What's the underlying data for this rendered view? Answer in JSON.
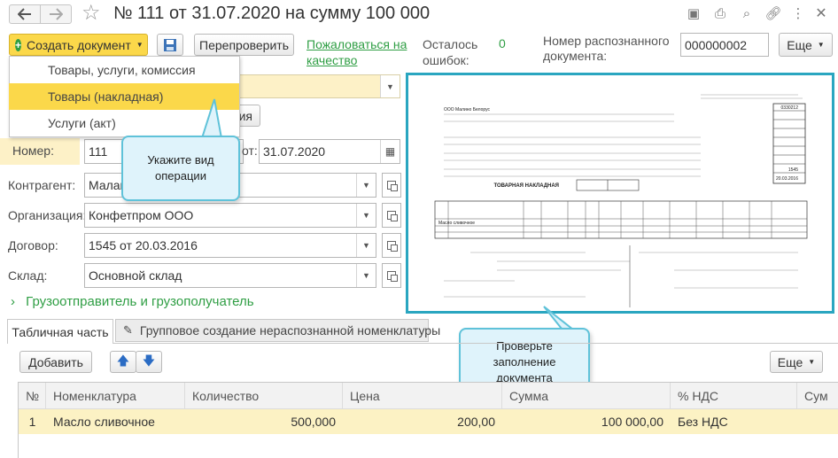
{
  "window": {
    "title": "№ 111 от 31.07.2020 на сумму 100 000"
  },
  "toolbar": {
    "create_doc_label": "Создать документ",
    "recheck_label": "Перепроверить",
    "complain_label": "Пожаловаться на качество",
    "errors_label": "Осталось ошибок:",
    "errors_value": "0",
    "recognized_label": "Номер распознанного документа:",
    "recognized_value": "000000002",
    "more_label": "Еще"
  },
  "menu": {
    "items": [
      "Товары, услуги, комиссия",
      "Товары (накладная)",
      "Услуги (акт)"
    ]
  },
  "form": {
    "partial_button": "ия",
    "number_label": "Номер:",
    "number_value": "111",
    "date_label_partial": "от:",
    "date_value": "31.07.2020",
    "contractor_label": "Контрагент:",
    "contractor_value": "Малак",
    "organization_label": "Организация:",
    "organization_value": "Конфетпром ООО",
    "contract_label": "Договор:",
    "contract_value": "1545 от 20.03.2016",
    "warehouse_label": "Склад:",
    "warehouse_value": "Основной склад",
    "shipper_section": "Грузоотправитель и грузополучатель"
  },
  "callouts": {
    "operation": "Укажите вид операции",
    "check": "Проверьте заполнение документа"
  },
  "tabs": {
    "table_part": "Табличная часть",
    "group_create": "Групповое создание нераспознанной номенклатуры"
  },
  "table_toolbar": {
    "add_label": "Добавить",
    "more_label": "Еще"
  },
  "table": {
    "headers": [
      "№",
      "Номенклатура",
      "Количество",
      "Цена",
      "Сумма",
      "% НДС",
      "Сум"
    ],
    "rows": [
      {
        "n": "1",
        "item": "Масло сливочное",
        "qty": "500,000",
        "price": "200,00",
        "sum": "100 000,00",
        "vat": "Без НДС"
      }
    ]
  },
  "scan_preview": {
    "doc_title": "ТОВАРНАЯ НАКЛАДНАЯ",
    "supplier": "ООО Малино Белорус",
    "consignee": "ООО \"Конфетпром\", ИНН 7708800000, 121170, Москва г, 1812 года ул, дом № 1, тел.: +7 (495) 5000055",
    "payer": "ООО \"Конфетпром\", ИНН 7708800000",
    "basis": "1545 от 20.03.2016",
    "okud": "0330212",
    "doc_number": "1545",
    "doc_date": "20.03.2016",
    "line_item": "Масло сливочное",
    "total_text": "сто тысяч рублей 00 копеек"
  },
  "colors": {
    "accent_green": "#2f9e44",
    "highlight": "#fbd84a",
    "callout_border": "#5fc2d9"
  }
}
